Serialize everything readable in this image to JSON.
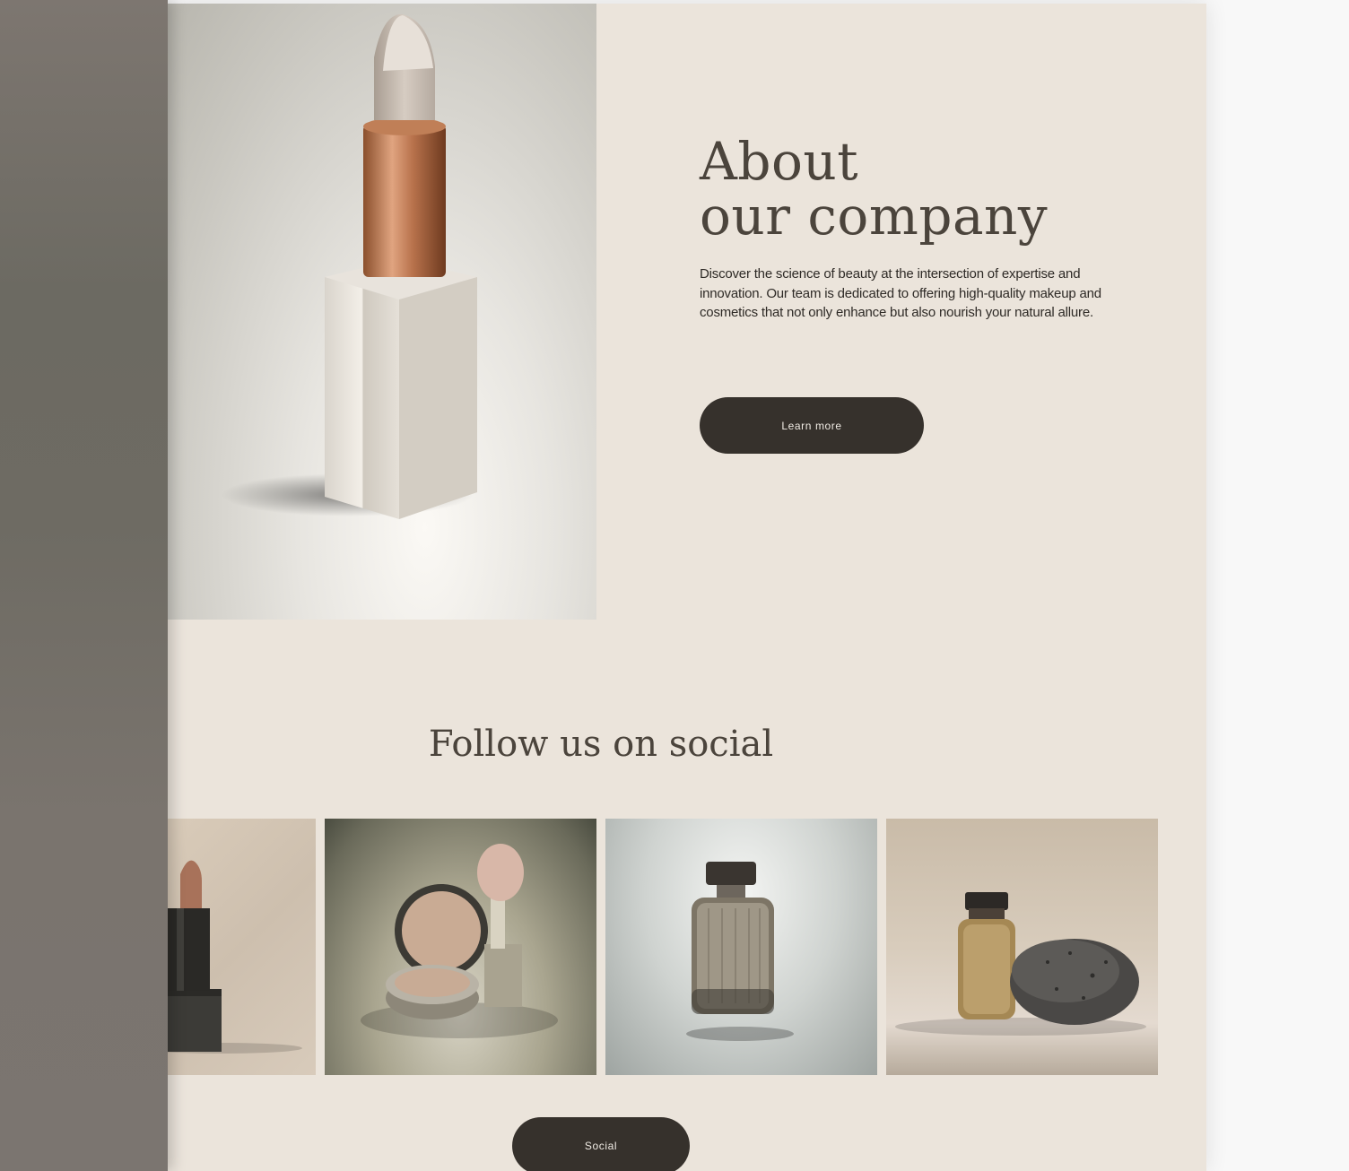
{
  "about": {
    "title_line1": "About",
    "title_line2": "our company",
    "description": "Discover the science of beauty at the intersection of expertise and innovation. Our team is dedicated to offering high-quality makeup and cosmetics that not only enhance but also nourish your natural allure.",
    "button_label": "Learn more"
  },
  "social": {
    "title": "Follow us on social",
    "button_label": "Social",
    "images": [
      "lipstick-photo",
      "compact-brush-photo",
      "perfume-bottle-photo",
      "serum-stone-photo"
    ]
  },
  "colors": {
    "page_bg": "#ebe4db",
    "heading": "#4b443c",
    "button_bg": "#36312c",
    "button_text": "#f0ebe4"
  }
}
